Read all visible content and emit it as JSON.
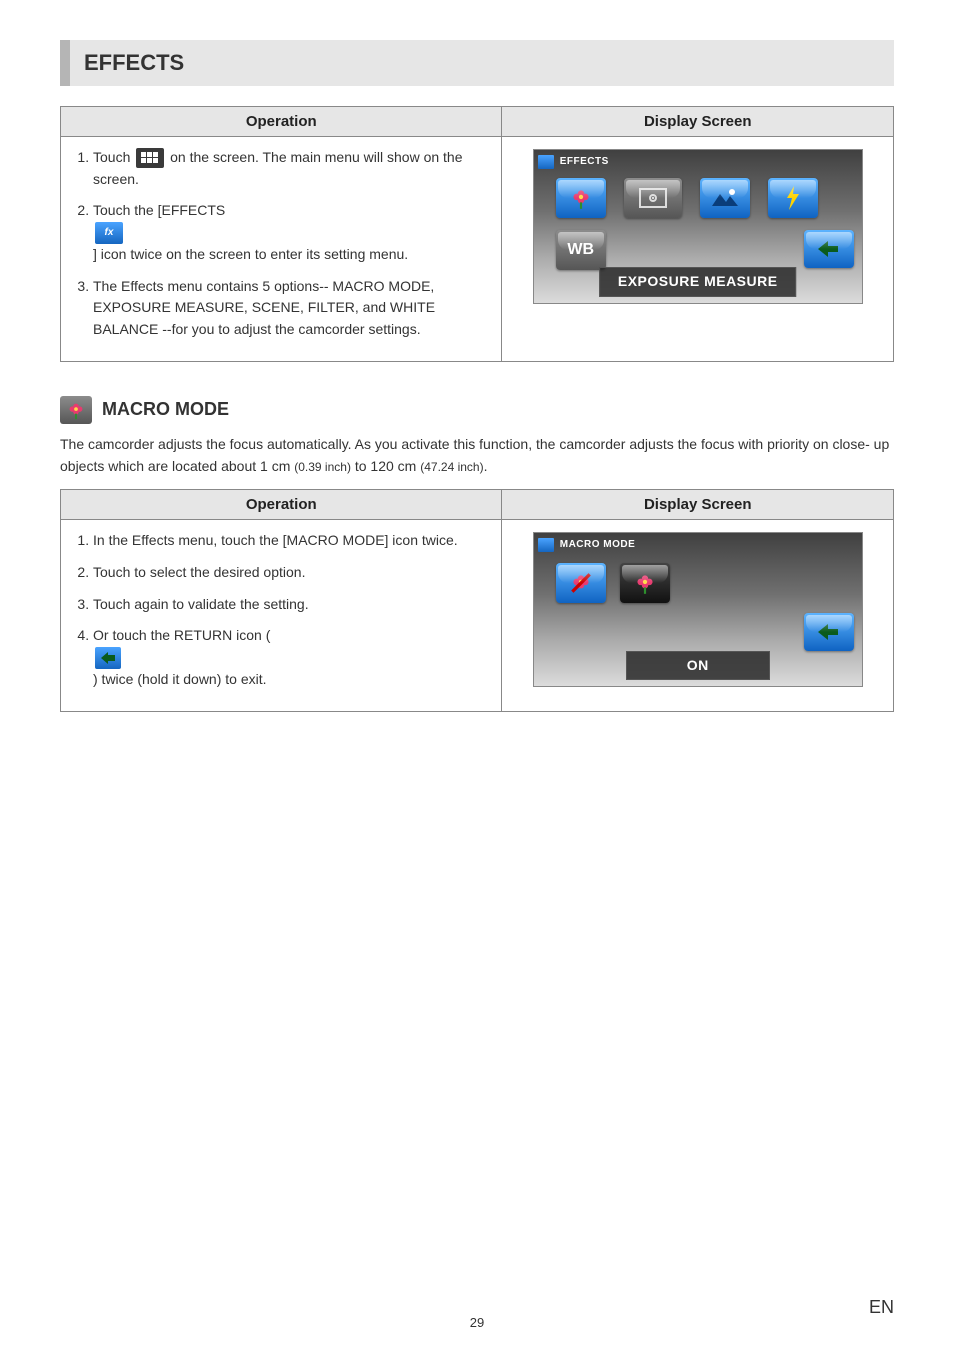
{
  "page": {
    "heading": "EFFECTS",
    "number": "29",
    "lang": "EN"
  },
  "table1": {
    "col_op": "Operation",
    "col_ds": "Display Screen",
    "s1a": "Touch ",
    "s1b": " on the screen. The main menu will show on the screen.",
    "s2a": "Touch the [EFFECTS ",
    "s2b": " ] icon twice on the screen to enter its setting menu.",
    "s3": "The Effects menu contains 5 options-- MACRO MODE, EXPOSURE MEASURE, SCENE, FILTER, and WHITE BALANCE --for you to adjust the camcorder settings.",
    "screen_title": "EFFECTS",
    "pill": "EXPOSURE MEASURE",
    "wb": "WB"
  },
  "macro": {
    "heading": "MACRO MODE",
    "intro_a": "The camcorder adjusts the focus automatically. As you activate this function, the camcorder adjusts the focus with priority on close- up objects which are located about 1 cm ",
    "intro_b": "(0.39 inch)",
    "intro_c": " to 120 cm ",
    "intro_d": "(47.24 inch)",
    "intro_e": "."
  },
  "table2": {
    "col_op": "Operation",
    "col_ds": "Display Screen",
    "s1": "In the Effects menu, touch the [MACRO MODE] icon twice.",
    "s2": "Touch to select the desired option.",
    "s3": "Touch again to validate the setting.",
    "s4a": "Or touch the RETURN icon ( ",
    "s4b": " ) twice (hold it down) to exit.",
    "screen_title": "MACRO MODE",
    "pill": "ON"
  }
}
